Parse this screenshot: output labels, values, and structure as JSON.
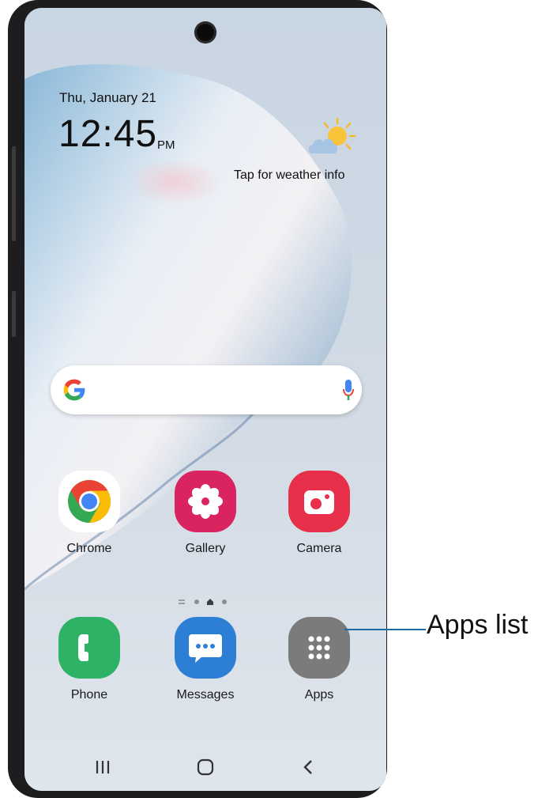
{
  "lock_widget": {
    "date": "Thu, January 21",
    "time": "12:45",
    "ampm": "PM",
    "weather_text": "Tap for weather info",
    "weather_icon": "partly-cloudy-sun-icon"
  },
  "search_bar": {
    "logo_icon": "google-g-icon",
    "mic_icon": "microphone-icon"
  },
  "apps_row": [
    {
      "label": "Chrome",
      "icon": "chrome-icon"
    },
    {
      "label": "Gallery",
      "icon": "gallery-flower-icon",
      "color": "#d9245f"
    },
    {
      "label": "Camera",
      "icon": "camera-icon",
      "color": "#e8304a"
    }
  ],
  "dock": [
    {
      "label": "Phone",
      "icon": "phone-icon",
      "color": "#2db266"
    },
    {
      "label": "Messages",
      "icon": "messages-icon",
      "color": "#2d7fd6"
    },
    {
      "label": "Apps",
      "icon": "apps-grid-icon",
      "color": "#7b7b7b"
    }
  ],
  "page_indicator": {
    "pages": 3,
    "active_index": 1
  },
  "navbar": {
    "recent_icon": "recent-apps-icon",
    "home_icon": "home-icon",
    "back_icon": "back-icon"
  },
  "callout": {
    "label": "Apps list",
    "color": "#1b6ca8"
  }
}
